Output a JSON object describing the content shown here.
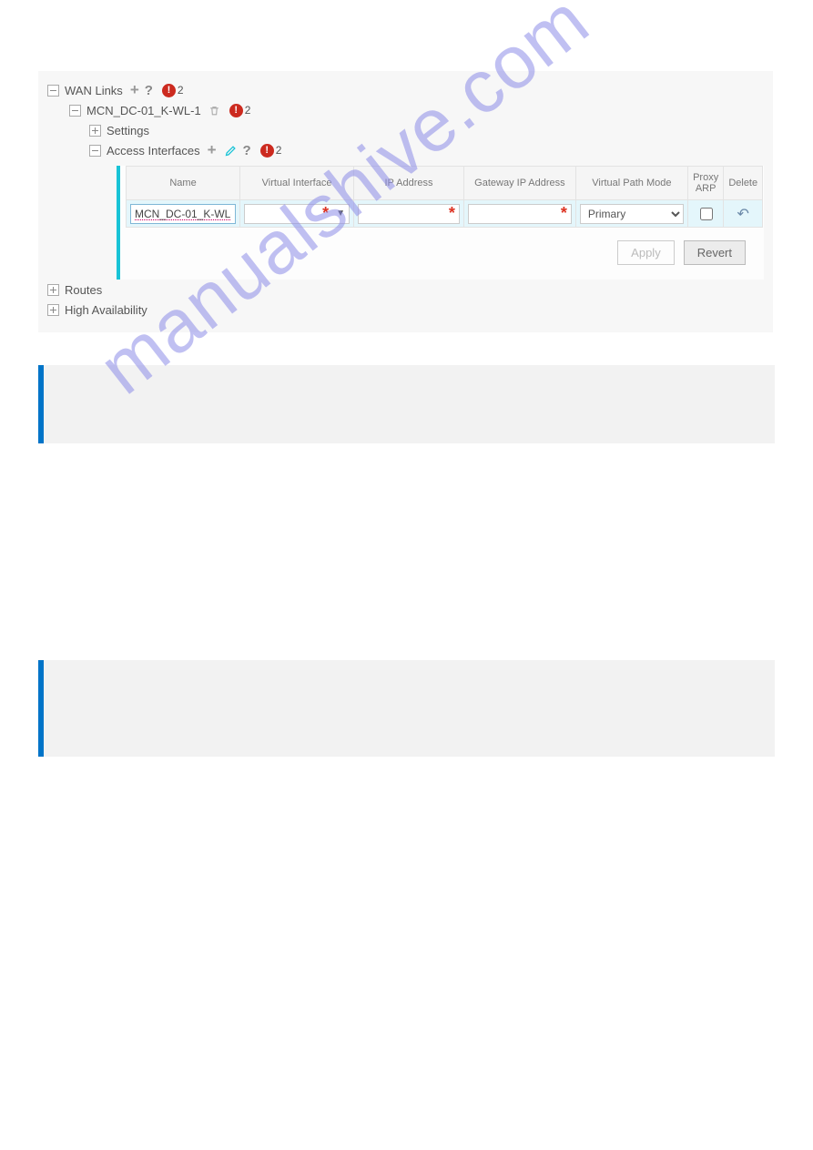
{
  "watermark": "manualshive.com",
  "tree": {
    "wan_links": {
      "label": "WAN Links",
      "err_count": "2",
      "child": {
        "label": "MCN_DC-01_K-WL-1",
        "err_count": "2",
        "settings_label": "Settings",
        "access_if": {
          "label": "Access Interfaces",
          "err_count": "2"
        }
      }
    },
    "routes_label": "Routes",
    "ha_label": "High Availability"
  },
  "table": {
    "headers": {
      "name": "Name",
      "vi": "Virtual Interface",
      "ip": "IP Address",
      "gw": "Gateway IP Address",
      "vpm": "Virtual Path Mode",
      "arp": "Proxy ARP",
      "del": "Delete"
    },
    "row": {
      "name_value": "MCN_DC-01_K-WL-",
      "vpm_value": "Primary"
    },
    "buttons": {
      "apply": "Apply",
      "revert": "Revert"
    }
  }
}
